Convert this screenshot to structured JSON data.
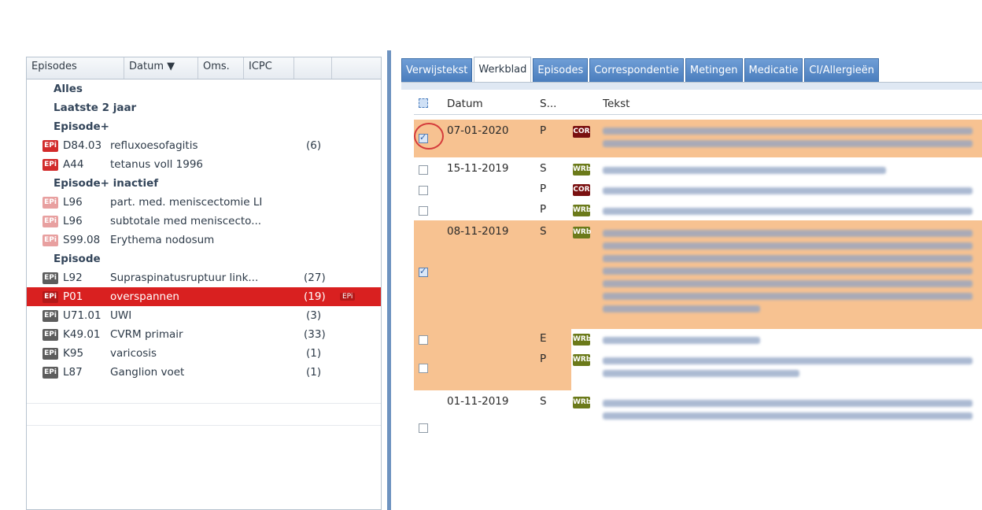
{
  "left": {
    "columns": [
      "Episodes",
      "Datum ▼",
      "Oms.",
      "ICPC"
    ],
    "groups": {
      "alles": "Alles",
      "laatste": "Laatste 2 jaar",
      "episode_plus": "Episode+",
      "episode_plus_inactief": "Episode+ inactief",
      "episode": "Episode"
    },
    "ep_label": "EPi",
    "rows": [
      {
        "code": "D84.03",
        "desc": "refluxoesofagitis",
        "count": "(6)"
      },
      {
        "code": "A44",
        "desc": "tetanus voll 1996",
        "count": ""
      },
      {
        "code": "L96",
        "desc": "part. med. meniscectomie LI",
        "count": ""
      },
      {
        "code": "L96",
        "desc": "subtotale med meniscecto...",
        "count": ""
      },
      {
        "code": "S99.08",
        "desc": "Erythema nodosum",
        "count": ""
      },
      {
        "code": "L92",
        "desc": "Supraspinatusruptuur link...",
        "count": "(27)"
      },
      {
        "code": "P01",
        "desc": "overspannen",
        "count": "(19)"
      },
      {
        "code": "U71.01",
        "desc": "UWI",
        "count": "(3)"
      },
      {
        "code": "K49.01",
        "desc": "CVRM primair",
        "count": "(33)"
      },
      {
        "code": "K95",
        "desc": "varicosis",
        "count": "(1)"
      },
      {
        "code": "L87",
        "desc": "Ganglion voet",
        "count": "(1)"
      }
    ]
  },
  "right": {
    "tabs": [
      "Verwijstekst",
      "Werkblad",
      "Episodes",
      "Correspondentie",
      "Metingen",
      "Medicatie",
      "CI/Allergieën"
    ],
    "active_tab": "Werkblad",
    "grid_headers": {
      "datum": "Datum",
      "soap": "S...",
      "tekst": "Tekst"
    },
    "tags": {
      "cor": "COR",
      "wrb": "WRb"
    },
    "entries": [
      {
        "date": "07-01-2020",
        "soap": "P",
        "tag": "COR",
        "checked": true
      },
      {
        "date": "15-11-2019",
        "soap": "S",
        "tag": "WRb",
        "checked": false
      },
      {
        "date": "",
        "soap": "P",
        "tag": "COR",
        "checked": false
      },
      {
        "date": "",
        "soap": "P",
        "tag": "WRb",
        "checked": false
      },
      {
        "date": "08-11-2019",
        "soap": "S",
        "tag": "WRb",
        "checked": true
      },
      {
        "date": "",
        "soap": "E",
        "tag": "WRb",
        "checked": false
      },
      {
        "date": "",
        "soap": "P",
        "tag": "WRb",
        "checked": false
      },
      {
        "date": "01-11-2019",
        "soap": "S",
        "tag": "WRb",
        "checked": false
      }
    ]
  },
  "colors": {
    "accent": "#4a7dbd",
    "selected_row": "#d92020",
    "highlight": "#f7c291"
  }
}
